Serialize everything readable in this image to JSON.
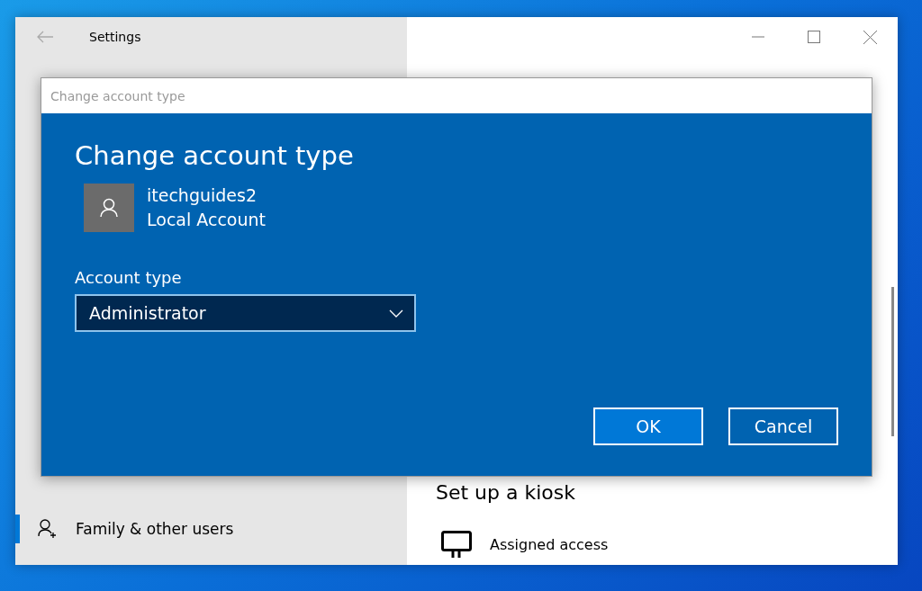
{
  "settings_window": {
    "title": "Settings"
  },
  "sidebar": {
    "items": [
      {
        "label": "Family & other users",
        "selected": true
      }
    ]
  },
  "content": {
    "heading": "Set up a kiosk",
    "items": [
      {
        "label": "Assigned access"
      }
    ]
  },
  "dialog": {
    "title": "Change account type",
    "heading": "Change account type",
    "user": {
      "name": "itechguides2",
      "account": "Local Account"
    },
    "account_type": {
      "label": "Account type",
      "value": "Administrator"
    },
    "buttons": [
      {
        "label": "OK",
        "kind": "primary"
      },
      {
        "label": "Cancel",
        "kind": "secondary"
      }
    ]
  }
}
